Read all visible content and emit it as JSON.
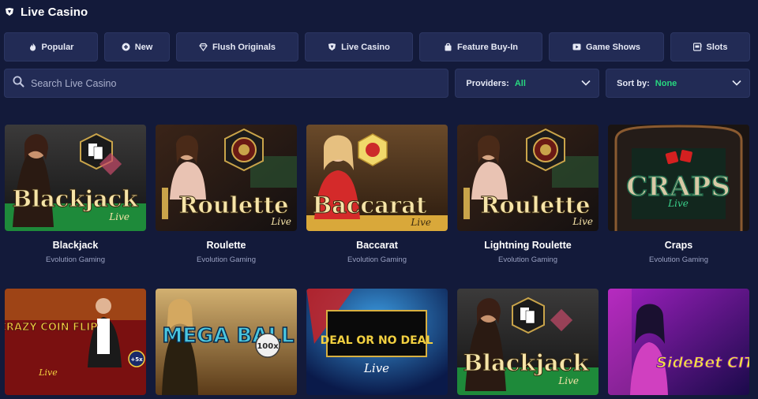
{
  "header": {
    "title": "Live Casino",
    "icon": "live-casino-icon"
  },
  "tabs": [
    {
      "label": "Popular",
      "icon": "flame-icon"
    },
    {
      "label": "New",
      "icon": "plus-circle-icon"
    },
    {
      "label": "Flush Originals",
      "icon": "diamond-icon"
    },
    {
      "label": "Live Casino",
      "icon": "live-casino-icon"
    },
    {
      "label": "Feature Buy-In",
      "icon": "shopping-bag-icon"
    },
    {
      "label": "Game Shows",
      "icon": "play-icon"
    },
    {
      "label": "Slots",
      "icon": "slot-machine-icon"
    }
  ],
  "search": {
    "placeholder": "Search Live Casino",
    "value": ""
  },
  "providers": {
    "label": "Providers:",
    "value": "All"
  },
  "sort": {
    "label": "Sort by:",
    "value": "None"
  },
  "games": [
    {
      "title": "Blackjack",
      "provider": "Evolution Gaming",
      "art": "Blackjack",
      "art_sub": "Live"
    },
    {
      "title": "Roulette",
      "provider": "Evolution Gaming",
      "art": "Roulette",
      "art_sub": "Live"
    },
    {
      "title": "Baccarat",
      "provider": "Evolution Gaming",
      "art": "Baccarat",
      "art_sub": "Live"
    },
    {
      "title": "Lightning Roulette",
      "provider": "Evolution Gaming",
      "art": "Roulette",
      "art_sub": "Live"
    },
    {
      "title": "Craps",
      "provider": "Evolution Gaming",
      "art": "CRAPS",
      "art_sub": "Live"
    }
  ],
  "games_row2": [
    {
      "art": "CRAZY COIN FLIP",
      "art_sub": "Live",
      "badge": "+5x"
    },
    {
      "art": "MEGA BALL",
      "badge": "100x"
    },
    {
      "art": "DEAL OR NO DEAL",
      "art_sub": "Live"
    },
    {
      "art": "Blackjack",
      "art_sub": "Live"
    },
    {
      "art": "SideBet CITY"
    }
  ],
  "colors": {
    "accent_green": "#28d77f",
    "bg": "#131a3a",
    "panel": "#222b55"
  }
}
